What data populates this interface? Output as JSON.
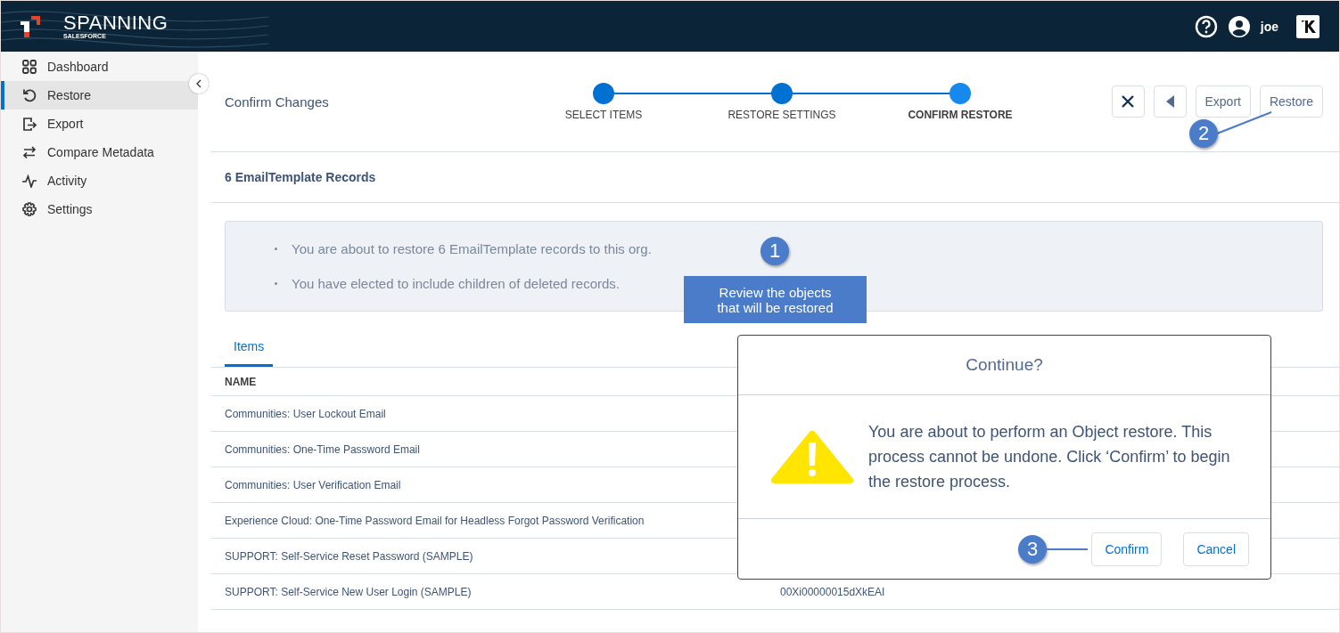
{
  "header": {
    "brand": "SPANNING",
    "brand_sub": "SALESFORCE",
    "user": "joe"
  },
  "sidebar": {
    "items": [
      {
        "label": "Dashboard",
        "selected": false
      },
      {
        "label": "Restore",
        "selected": true
      },
      {
        "label": "Export",
        "selected": false
      },
      {
        "label": "Compare Metadata",
        "selected": false
      },
      {
        "label": "Activity",
        "selected": false
      },
      {
        "label": "Settings",
        "selected": false
      }
    ]
  },
  "page": {
    "title": "Confirm Changes",
    "steps": [
      {
        "label": "SELECT ITEMS",
        "selected": false
      },
      {
        "label": "RESTORE SETTINGS",
        "selected": false
      },
      {
        "label": "CONFIRM RESTORE",
        "selected": true
      }
    ],
    "actions": [
      {
        "kind": "close"
      },
      {
        "kind": "back"
      },
      {
        "kind": "text",
        "label": "Export"
      },
      {
        "kind": "text",
        "label": "Restore"
      }
    ],
    "actions_callout": "2"
  },
  "records_heading": "6 EmailTemplate Records",
  "info_box": {
    "bullets": [
      "You are about to restore 6 EmailTemplate records to this org.",
      "You have elected to include children of deleted records."
    ],
    "callout": {
      "number": "1",
      "text": "Review the objects that will be restored"
    }
  },
  "tabs": [
    {
      "label": "Items",
      "selected": true
    }
  ],
  "table": {
    "columns": [
      "NAME"
    ],
    "rows": [
      {
        "name": "Communities: User Lockout Email"
      },
      {
        "name": "Communities: One-Time Password Email"
      },
      {
        "name": "Communities: User Verification Email"
      },
      {
        "name": "Experience Cloud: One-Time Password Email for Headless Forgot Password Verification"
      },
      {
        "name": "SUPPORT: Self-Service Reset Password (SAMPLE)"
      },
      {
        "name": "SUPPORT: Self-Service New User Login (SAMPLE)",
        "id": "00Xi00000015dXkEAI"
      }
    ]
  },
  "dialog": {
    "title": "Continue?",
    "message": "You are about to perform an Object restore. This process cannot be undone. Click ‘Confirm’ to begin the restore process.",
    "buttons": [
      "Confirm",
      "Cancel"
    ],
    "callout": "3"
  }
}
